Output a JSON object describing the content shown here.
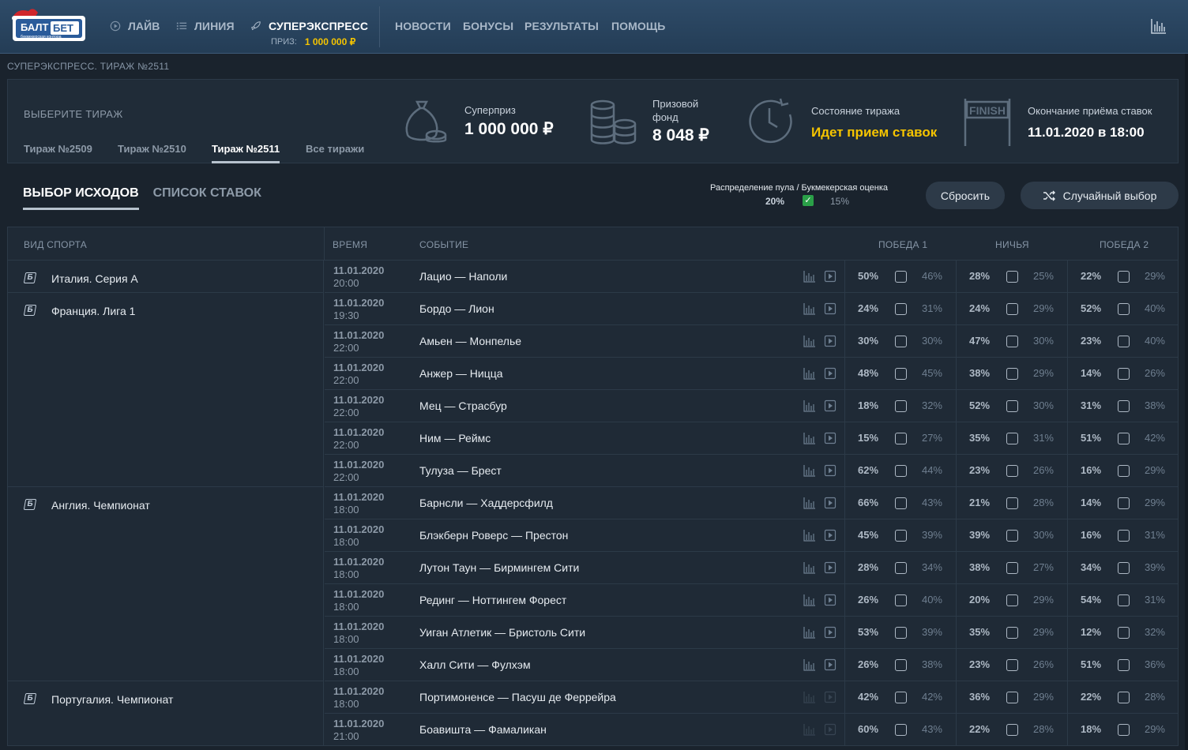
{
  "header": {
    "logo_text_top": "БАЛТ",
    "logo_text_bet": "БЕТ",
    "logo_sub": "букмекерская контора",
    "nav": [
      {
        "label": "ЛАЙВ",
        "icon": "play-circle-icon"
      },
      {
        "label": "ЛИНИЯ",
        "icon": "list-icon"
      },
      {
        "label": "СУПЕРЭКСПРЕСС",
        "icon": "rocket-icon"
      }
    ],
    "prize_label": "ПРИЗ:",
    "prize_value": "1 000 000 ₽",
    "nav2": [
      "НОВОСТИ",
      "БОНУСЫ",
      "РЕЗУЛЬТАТЫ",
      "ПОМОЩЬ"
    ]
  },
  "breadcrumb": "СУПЕРЭКСПРЕСС. ТИРАЖ №2511",
  "draws": {
    "label": "ВЫБЕРИТЕ ТИРАЖ",
    "tabs": [
      "Тираж №2509",
      "Тираж №2510",
      "Тираж №2511",
      "Все тиражи"
    ],
    "active": "Тираж №2511"
  },
  "info": {
    "superprize_label": "Суперприз",
    "superprize_value": "1 000 000 ₽",
    "fund_label_1": "Призовой",
    "fund_label_2": "фонд",
    "fund_value": "8 048 ₽",
    "state_label": "Состояние тиража",
    "state_value": "Идет прием ставок",
    "end_label": "Окончание приёма ставок",
    "end_value": "11.01.2020 в 18:00",
    "finish_text": "FINISH"
  },
  "section_tabs": [
    "ВЫБОР ИСХОДОВ",
    "СПИСОК СТАВОК"
  ],
  "pool": {
    "label": "Распределение пула / Букмекерская оценка",
    "a": "20%",
    "b": "15%"
  },
  "buttons": {
    "reset": "Сбросить",
    "random": "Случайный выбор"
  },
  "table": {
    "headers": {
      "sport": "ВИД СПОРТА",
      "time": "ВРЕМЯ",
      "event": "СОБЫТИЕ",
      "w1": "ПОБЕДА 1",
      "draw": "НИЧЬЯ",
      "w2": "ПОБЕДА 2"
    },
    "sports": [
      {
        "name": "Италия. Серия А",
        "rows": 1
      },
      {
        "name": "Франция. Лига 1",
        "rows": 6
      },
      {
        "name": "Англия. Чемпионат",
        "rows": 6
      },
      {
        "name": "Португалия. Чемпионат",
        "rows": 2
      }
    ],
    "rows": [
      {
        "date": "11.01.2020",
        "time": "20:00",
        "event": "Лацио — Наполи",
        "o": [
          [
            "50%",
            "46%"
          ],
          [
            "28%",
            "25%"
          ],
          [
            "22%",
            "29%"
          ]
        ]
      },
      {
        "date": "11.01.2020",
        "time": "19:30",
        "event": "Бордо — Лион",
        "o": [
          [
            "24%",
            "31%"
          ],
          [
            "24%",
            "29%"
          ],
          [
            "52%",
            "40%"
          ]
        ]
      },
      {
        "date": "11.01.2020",
        "time": "22:00",
        "event": "Амьен — Монпелье",
        "o": [
          [
            "30%",
            "30%"
          ],
          [
            "47%",
            "30%"
          ],
          [
            "23%",
            "40%"
          ]
        ]
      },
      {
        "date": "11.01.2020",
        "time": "22:00",
        "event": "Анжер — Ницца",
        "o": [
          [
            "48%",
            "45%"
          ],
          [
            "38%",
            "29%"
          ],
          [
            "14%",
            "26%"
          ]
        ]
      },
      {
        "date": "11.01.2020",
        "time": "22:00",
        "event": "Мец — Страсбур",
        "o": [
          [
            "18%",
            "32%"
          ],
          [
            "52%",
            "30%"
          ],
          [
            "31%",
            "38%"
          ]
        ]
      },
      {
        "date": "11.01.2020",
        "time": "22:00",
        "event": "Ним — Реймс",
        "o": [
          [
            "15%",
            "27%"
          ],
          [
            "35%",
            "31%"
          ],
          [
            "51%",
            "42%"
          ]
        ]
      },
      {
        "date": "11.01.2020",
        "time": "22:00",
        "event": "Тулуза — Брест",
        "o": [
          [
            "62%",
            "44%"
          ],
          [
            "23%",
            "26%"
          ],
          [
            "16%",
            "29%"
          ]
        ]
      },
      {
        "date": "11.01.2020",
        "time": "18:00",
        "event": "Барнсли — Хаддерсфилд",
        "o": [
          [
            "66%",
            "43%"
          ],
          [
            "21%",
            "28%"
          ],
          [
            "14%",
            "29%"
          ]
        ]
      },
      {
        "date": "11.01.2020",
        "time": "18:00",
        "event": "Блэкберн Роверс — Престон",
        "o": [
          [
            "45%",
            "39%"
          ],
          [
            "39%",
            "30%"
          ],
          [
            "16%",
            "31%"
          ]
        ]
      },
      {
        "date": "11.01.2020",
        "time": "18:00",
        "event": "Лутон Таун — Бирмингем Сити",
        "o": [
          [
            "28%",
            "34%"
          ],
          [
            "38%",
            "27%"
          ],
          [
            "34%",
            "39%"
          ]
        ]
      },
      {
        "date": "11.01.2020",
        "time": "18:00",
        "event": "Рединг — Ноттингем Форест",
        "o": [
          [
            "26%",
            "40%"
          ],
          [
            "20%",
            "29%"
          ],
          [
            "54%",
            "31%"
          ]
        ]
      },
      {
        "date": "11.01.2020",
        "time": "18:00",
        "event": "Уиган Атлетик — Бристоль Сити",
        "o": [
          [
            "53%",
            "39%"
          ],
          [
            "35%",
            "29%"
          ],
          [
            "12%",
            "32%"
          ]
        ]
      },
      {
        "date": "11.01.2020",
        "time": "18:00",
        "event": "Халл Сити — Фулхэм",
        "o": [
          [
            "26%",
            "38%"
          ],
          [
            "23%",
            "26%"
          ],
          [
            "51%",
            "36%"
          ]
        ]
      },
      {
        "date": "11.01.2020",
        "time": "18:00",
        "event": "Портимоненсе — Пасуш де Феррейра",
        "o": [
          [
            "42%",
            "42%"
          ],
          [
            "36%",
            "29%"
          ],
          [
            "22%",
            "28%"
          ]
        ],
        "dim": true
      },
      {
        "date": "11.01.2020",
        "time": "21:00",
        "event": "Боавишта — Фамаликан",
        "o": [
          [
            "60%",
            "43%"
          ],
          [
            "22%",
            "28%"
          ],
          [
            "18%",
            "29%"
          ]
        ],
        "dim": true
      }
    ]
  },
  "colors": {
    "accent_yellow": "#f5c400",
    "header_bg": "#2e4b68",
    "page_bg": "#1a232d",
    "check_green": "#2aa048"
  }
}
